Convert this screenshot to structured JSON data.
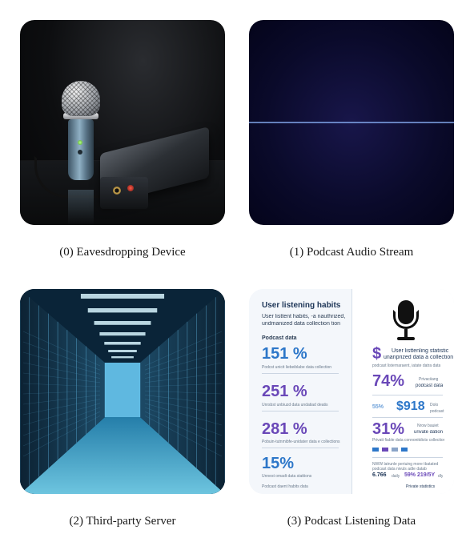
{
  "panels": [
    {
      "caption": "(0) Eavesdropping Device",
      "icon": "microphone-recorder-photo"
    },
    {
      "caption": "(1) Podcast Audio Stream",
      "icon": "audio-waveform-image"
    },
    {
      "caption": "(2) Third-party Server",
      "icon": "server-room-photo"
    },
    {
      "caption": "(3) Podcast Listening Data",
      "icon": "infographic-image"
    }
  ],
  "infographic": {
    "title": "User listening habits",
    "subtitle_line1": "User listtent habits, -a nauthrized,",
    "subtitle_line2": "undmanized data collection tion",
    "section_label": "Podcast data",
    "left_stats": [
      {
        "value": "151 %",
        "note": "Podcst unicit liebeiblabe data collection"
      },
      {
        "value": "251 %",
        "note": "Unrsbst unbiuzd data undatiad deatis"
      },
      {
        "value": "281 %",
        "note": "Pobuin-tutnmibfe-unidater data e collections"
      },
      {
        "value": "15%",
        "note": "Unnest omadt data stattions"
      }
    ],
    "left_footer": "Podcast daent habits data",
    "right_header_symbol": "$",
    "right_header_line1": "User listtenling statistic",
    "right_header_line2": "unanprized data a collection",
    "right_header_note": "podcast listernaraent, iatate datra data",
    "right_stats": [
      {
        "value": "74%",
        "note1": "Privaciiang",
        "note2": "podcast data"
      },
      {
        "value": "$918",
        "prefix": "55%",
        "note1": "Dolo",
        "note2": "podcast"
      },
      {
        "value": "31%",
        "note1": "Nrow bauiet",
        "note2": "urivate dation"
      }
    ],
    "right_note_31": "Privatt fiable data connonitdicts collection",
    "right_legend": "NWW latrunle   periuing more tbatated",
    "right_legend2": "podcast data   nivuls adte datab",
    "right_bottom_left": "6.766",
    "right_bottom_left_suffix": "daily",
    "right_bottom_right": "59%  219/5Y",
    "right_bottom_right_suffix": "dly",
    "right_footer": "Private statistics"
  }
}
